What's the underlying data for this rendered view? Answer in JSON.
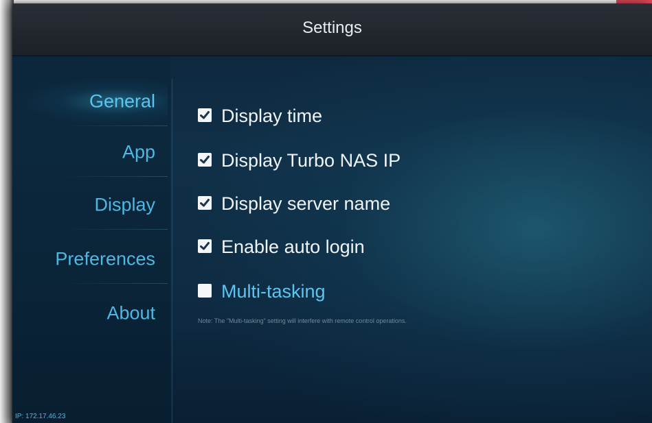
{
  "header": {
    "title": "Settings"
  },
  "sidebar": {
    "items": [
      {
        "label": "General",
        "active": true
      },
      {
        "label": "App",
        "active": false
      },
      {
        "label": "Display",
        "active": false
      },
      {
        "label": "Preferences",
        "active": false
      },
      {
        "label": "About",
        "active": false
      }
    ]
  },
  "options": {
    "items": [
      {
        "label": "Display time",
        "checked": true
      },
      {
        "label": "Display Turbo NAS IP",
        "checked": true
      },
      {
        "label": "Display server name",
        "checked": true
      },
      {
        "label": "Enable auto login",
        "checked": true
      },
      {
        "label": "Multi-tasking",
        "checked": false
      }
    ],
    "note": "Note: The \"Multi-tasking\" setting will interfere with remote control operations."
  },
  "footer": {
    "ip": "IP: 172.17.46.23"
  },
  "colors": {
    "accent": "#4fb7e3",
    "background": "#103048",
    "titlebar": "#23282f",
    "corner_accent": "#e0485a"
  },
  "icons": {
    "checked": "checkbox-checked-icon",
    "unchecked": "checkbox-unchecked-icon"
  }
}
